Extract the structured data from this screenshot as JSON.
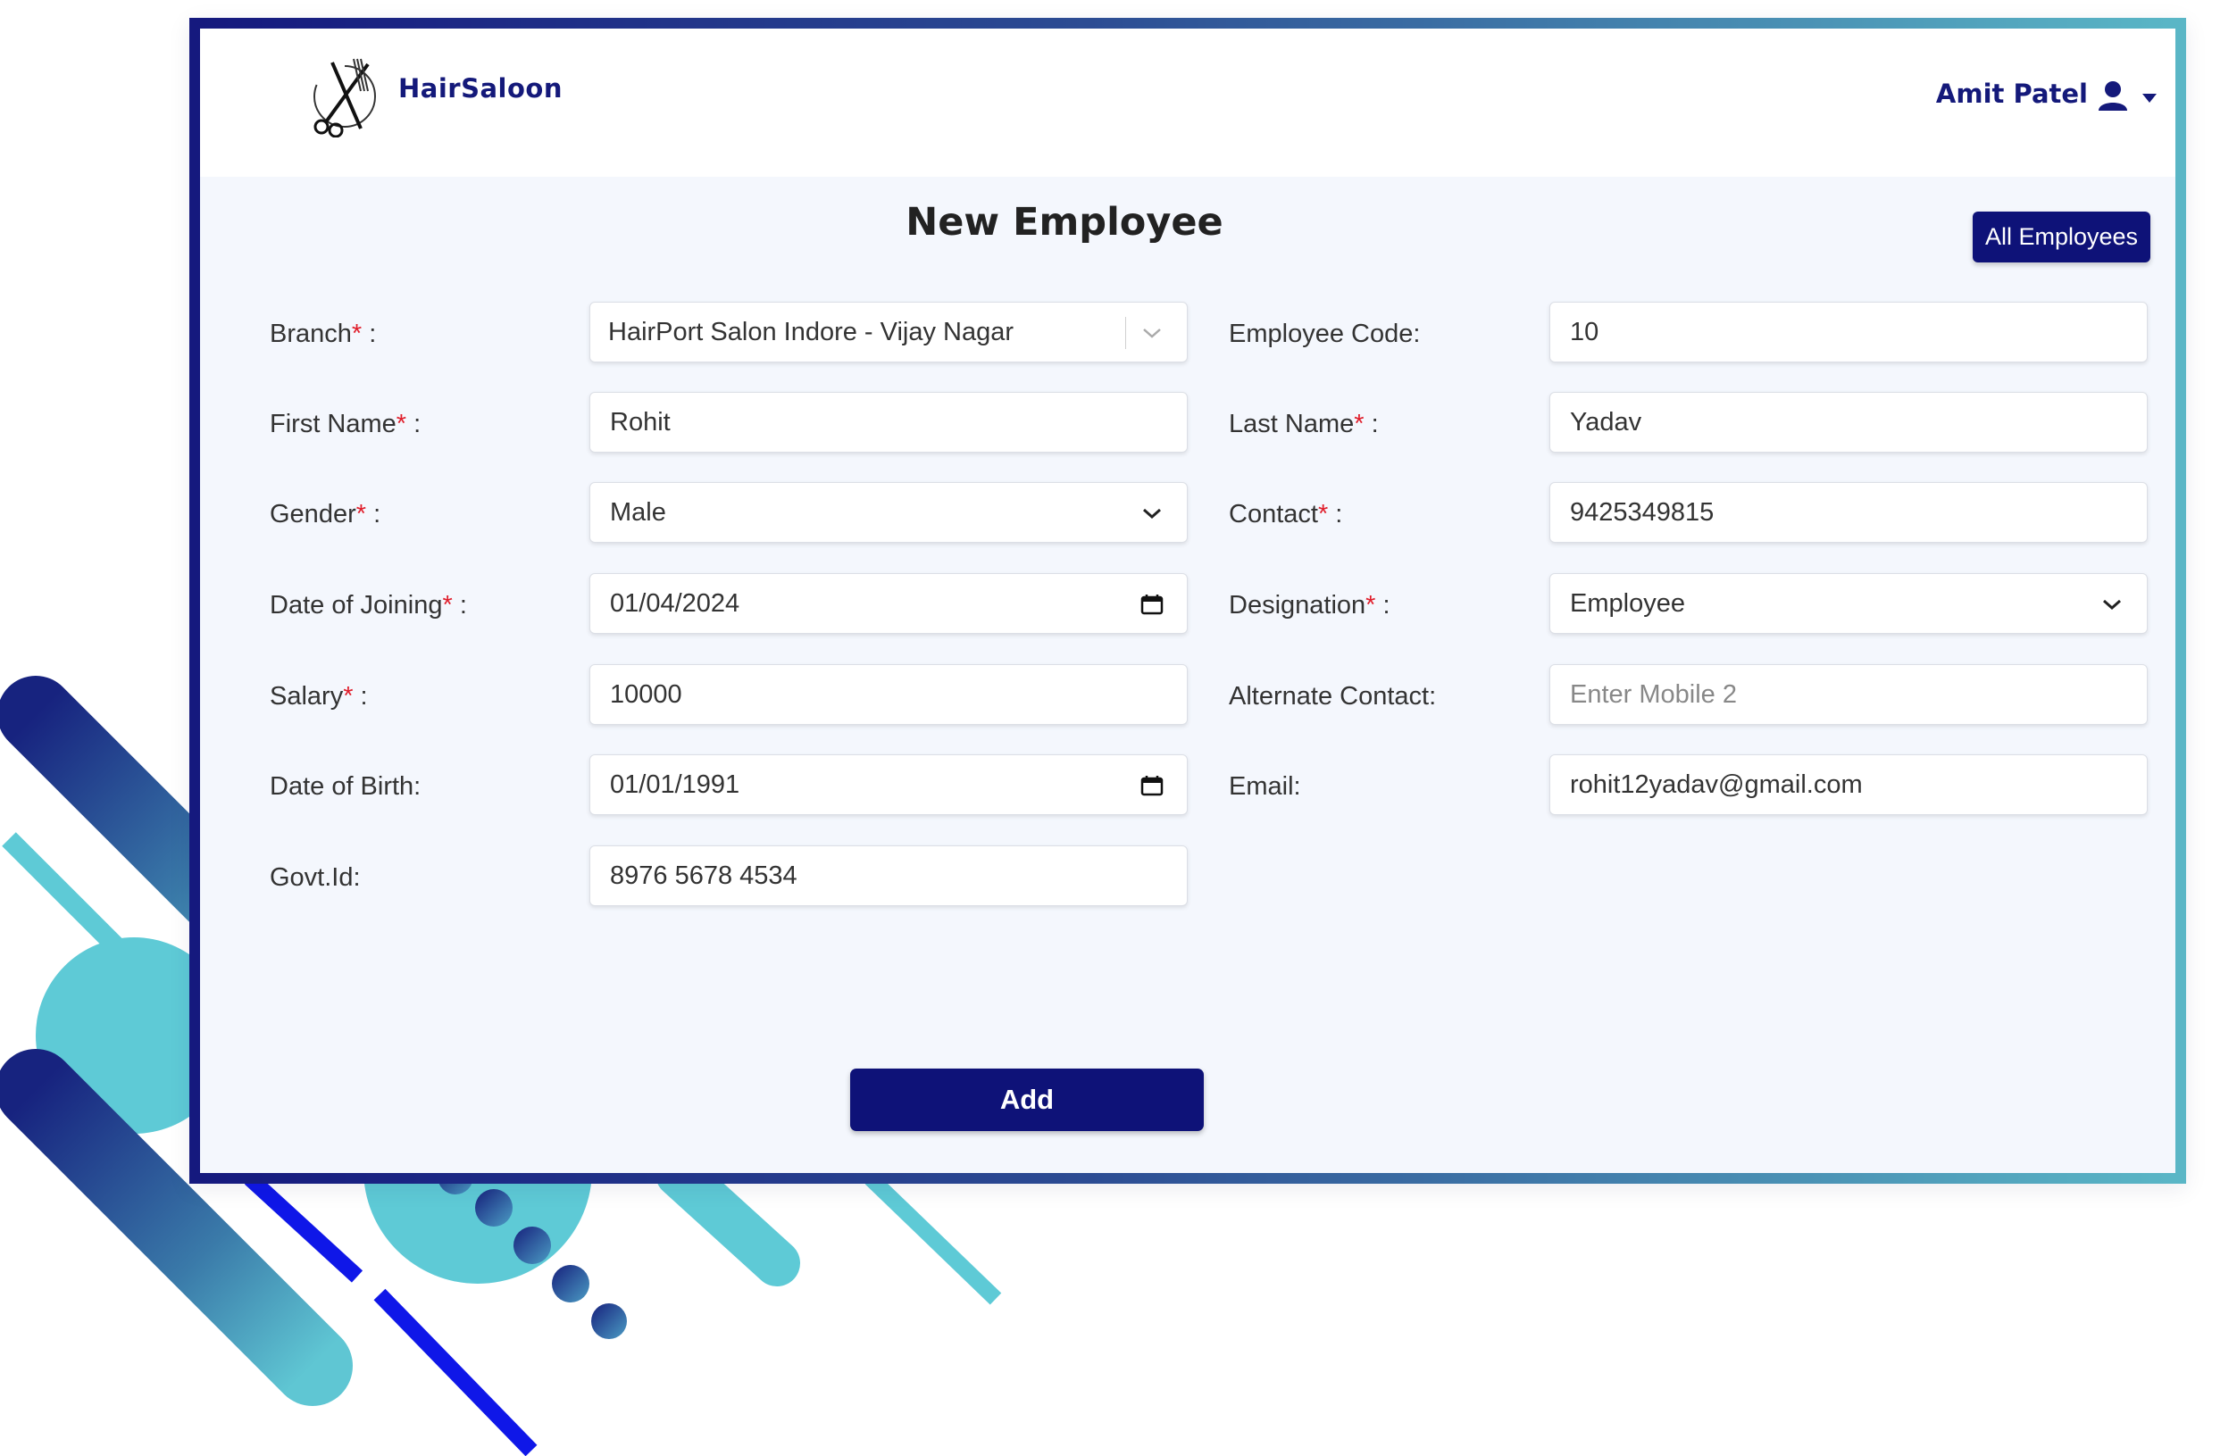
{
  "app": {
    "brand": "HairSaloon",
    "user_name": "Amit Patel"
  },
  "page": {
    "title": "New Employee",
    "all_employees_button": "All Employees",
    "add_button": "Add"
  },
  "form": {
    "required_mark": "*",
    "branch": {
      "label": "Branch",
      "suffix": " :",
      "value": "HairPort Salon Indore - Vijay Nagar"
    },
    "employee_code": {
      "label": "Employee Code:",
      "value": "10"
    },
    "first_name": {
      "label": "First Name",
      "suffix": " :",
      "value": "Rohit"
    },
    "last_name": {
      "label": "Last Name",
      "suffix": " :",
      "value": "Yadav"
    },
    "gender": {
      "label": "Gender",
      "suffix": " :",
      "value": "Male"
    },
    "contact": {
      "label": "Contact",
      "suffix": " :",
      "value": "9425349815"
    },
    "date_of_joining": {
      "label": "Date of Joining",
      "suffix": " :",
      "value": "01/04/2024"
    },
    "designation": {
      "label": "Designation",
      "suffix": " :",
      "value": "Employee"
    },
    "salary": {
      "label": "Salary",
      "suffix": " :",
      "value": "10000"
    },
    "alternate_contact": {
      "label": "Alternate Contact:",
      "placeholder": "Enter Mobile 2"
    },
    "date_of_birth": {
      "label": "Date of Birth:",
      "value": "01/01/1991"
    },
    "email": {
      "label": "Email:",
      "value": "rohit12yadav@gmail.com"
    },
    "govt_id": {
      "label": "Govt.Id:",
      "value": "8976 5678 4534"
    }
  },
  "colors": {
    "primary": "#0e1278",
    "required": "#e01e2b",
    "accent": "#5ecad6",
    "page_bg": "#f4f7fd"
  },
  "icons": {
    "logo": "scissors-comb-logo",
    "user": "user-icon",
    "caret": "caret-down-icon",
    "chevron": "chevron-down-icon",
    "calendar": "calendar-icon"
  }
}
